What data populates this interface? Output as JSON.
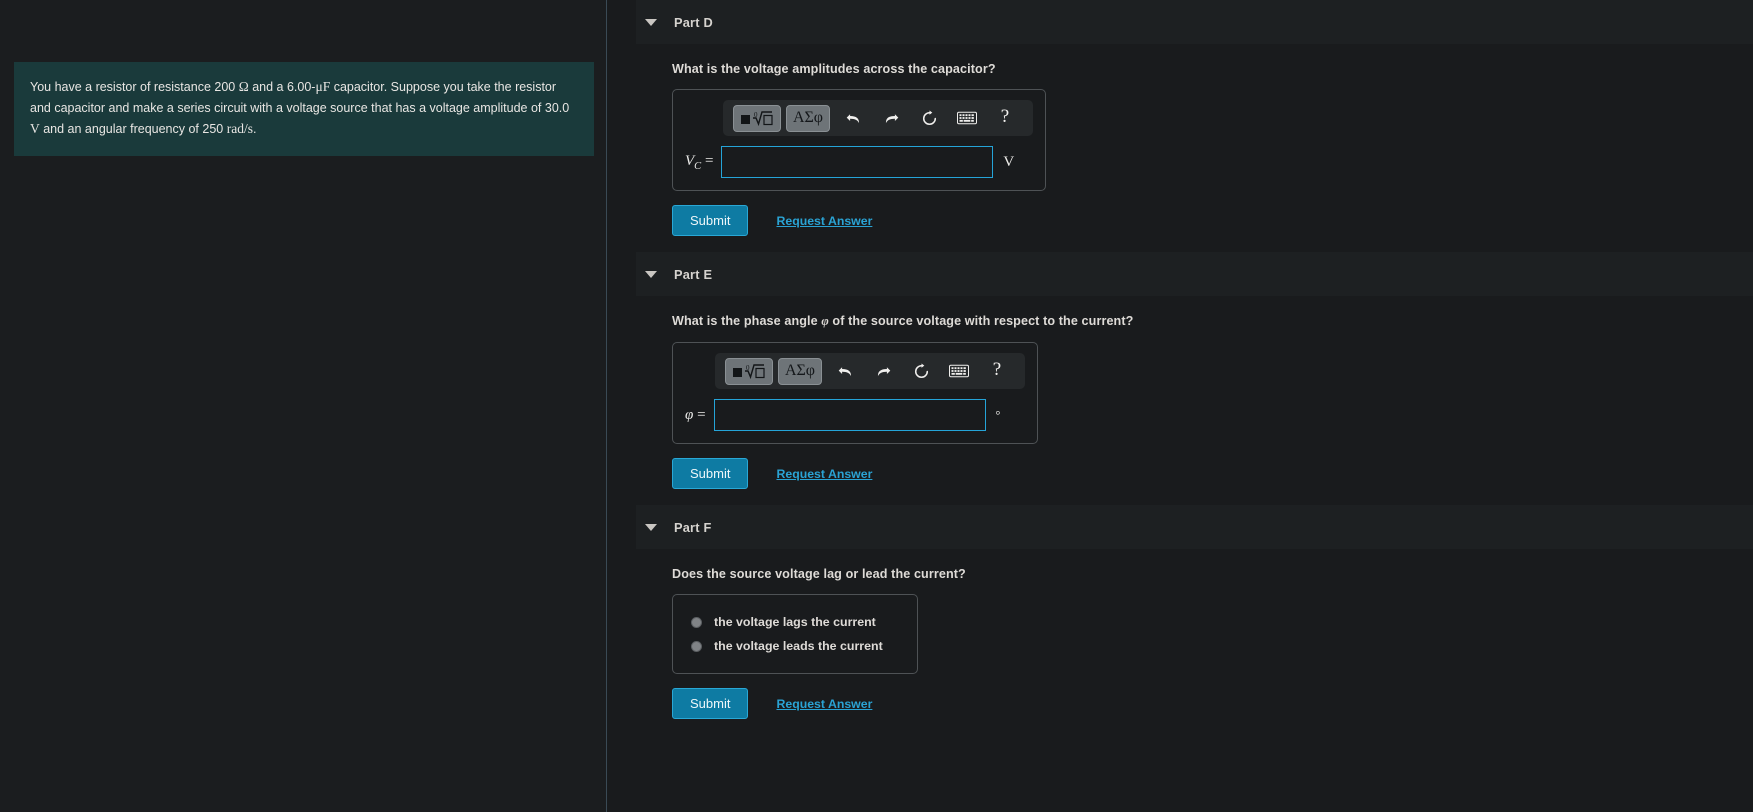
{
  "theme": {
    "page_bg": "#191b1d",
    "left_panel_bg": "#1b1d1f",
    "problem_bg": "#1a3a3b",
    "accent_blue": "#25a4d8",
    "submit_bg": "#0e7ba3",
    "link_color": "#2aa3d4",
    "header_bar_bg": "#1d2022",
    "rail_color": "#3a4a55"
  },
  "problem": {
    "seg1": "You have a resistor of resistance 200 ",
    "ohm": "Ω",
    "seg2": " and a 6.00-",
    "muF": "μF",
    "seg3": " capacitor. Suppose you take the resistor and capacitor and make a series circuit with a voltage source that has a voltage amplitude of 30.0 ",
    "volt": "V",
    "seg4": " and an angular frequency of 250 ",
    "radps": "rad/s",
    "seg5": "."
  },
  "toolbar": {
    "template_button": "template-symbol",
    "greek_button": "ΑΣφ",
    "undo": "undo-icon",
    "redo": "redo-icon",
    "reset": "reset-icon",
    "keyboard": "keyboard-icon",
    "help": "?"
  },
  "parts": [
    {
      "id": "part-d",
      "title": "Part D",
      "question": "What is the voltage amplitudes across the capacitor?",
      "type": "input",
      "var_main": "V",
      "var_sub": "C",
      "equals": "=",
      "input_value": "",
      "input_placeholder": "",
      "unit": "V",
      "unit_kind": "text",
      "input_width": 272,
      "toolbar_indent": 38,
      "submit_label": "Submit",
      "request_label": "Request Answer"
    },
    {
      "id": "part-e",
      "title": "Part E",
      "question_pre": "What is the phase angle ",
      "question_sym": "φ",
      "question_post": " of the source voltage with respect to the current?",
      "question": "What is the phase angle φ of the source voltage with respect to the current?",
      "type": "input",
      "var_main": "φ",
      "var_sub": "",
      "equals": "=",
      "input_value": "",
      "input_placeholder": "",
      "unit": "o",
      "unit_kind": "degree",
      "input_width": 272,
      "toolbar_indent": 30,
      "submit_label": "Submit",
      "request_label": "Request Answer"
    },
    {
      "id": "part-f",
      "title": "Part F",
      "question": "Does the source voltage lag or lead the current?",
      "type": "radio",
      "options": [
        {
          "label": "the voltage lags the current",
          "selected": false
        },
        {
          "label": "the voltage leads the current",
          "selected": false
        }
      ],
      "submit_label": "Submit",
      "request_label": "Request Answer"
    }
  ]
}
